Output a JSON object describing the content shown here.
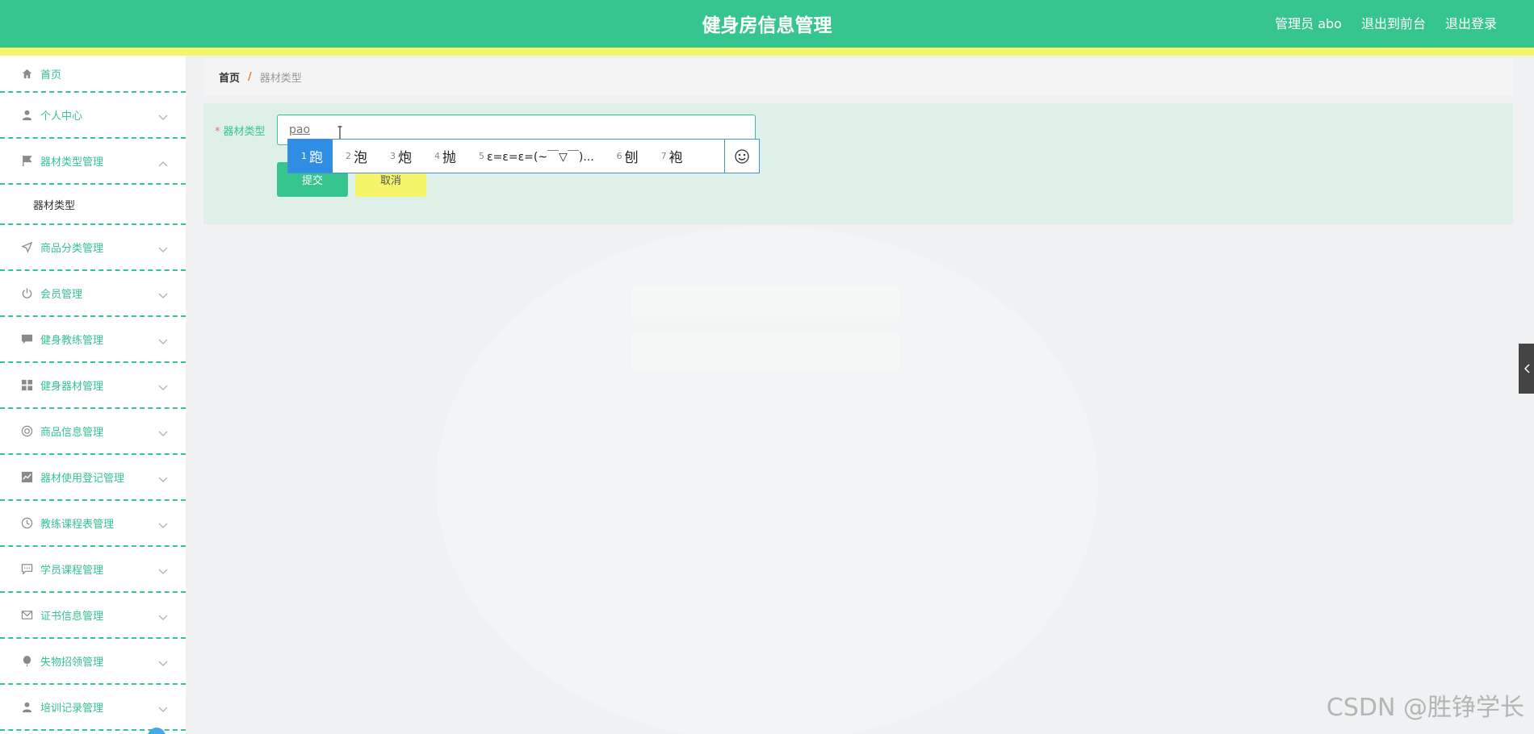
{
  "header": {
    "title": "健身房信息管理",
    "user": "管理员 abo",
    "to_front": "退出到前台",
    "logout": "退出登录"
  },
  "sidebar": {
    "items": [
      {
        "label": "首页",
        "icon": "home-icon"
      },
      {
        "label": "个人中心",
        "icon": "user-icon"
      },
      {
        "label": "器材类型管理",
        "icon": "flag-icon",
        "expanded": true,
        "children": [
          "器材类型"
        ]
      },
      {
        "label": "商品分类管理",
        "icon": "send-icon"
      },
      {
        "label": "会员管理",
        "icon": "power-icon"
      },
      {
        "label": "健身教练管理",
        "icon": "chat-icon"
      },
      {
        "label": "健身器材管理",
        "icon": "grid-icon"
      },
      {
        "label": "商品信息管理",
        "icon": "lifebuoy-icon"
      },
      {
        "label": "器材使用登记管理",
        "icon": "chart-icon"
      },
      {
        "label": "教练课程表管理",
        "icon": "clock-icon"
      },
      {
        "label": "学员课程管理",
        "icon": "message-icon"
      },
      {
        "label": "证书信息管理",
        "icon": "mail-icon"
      },
      {
        "label": "失物招领管理",
        "icon": "balloon-icon"
      },
      {
        "label": "培训记录管理",
        "icon": "user-icon"
      }
    ]
  },
  "breadcrumb": {
    "home": "首页",
    "separator": "/",
    "current": "器材类型"
  },
  "form": {
    "label": "器材类型",
    "required_mark": "*",
    "input_value": "pao",
    "submit_label": "提交",
    "cancel_label": "取消"
  },
  "ime": {
    "candidates": [
      {
        "num": "1",
        "text": "跑"
      },
      {
        "num": "2",
        "text": "泡"
      },
      {
        "num": "3",
        "text": "炮"
      },
      {
        "num": "4",
        "text": "抛"
      },
      {
        "num": "5",
        "text": "ε=ε=ε=(~￣▽￣)..."
      },
      {
        "num": "6",
        "text": "刨"
      },
      {
        "num": "7",
        "text": "袍"
      }
    ],
    "selected_index": 0
  },
  "watermark": "CSDN @胜铮学长",
  "colors": {
    "primary": "#36c48f",
    "accent_yellow": "#f6f56a",
    "ime_highlight": "#2f8de4"
  }
}
